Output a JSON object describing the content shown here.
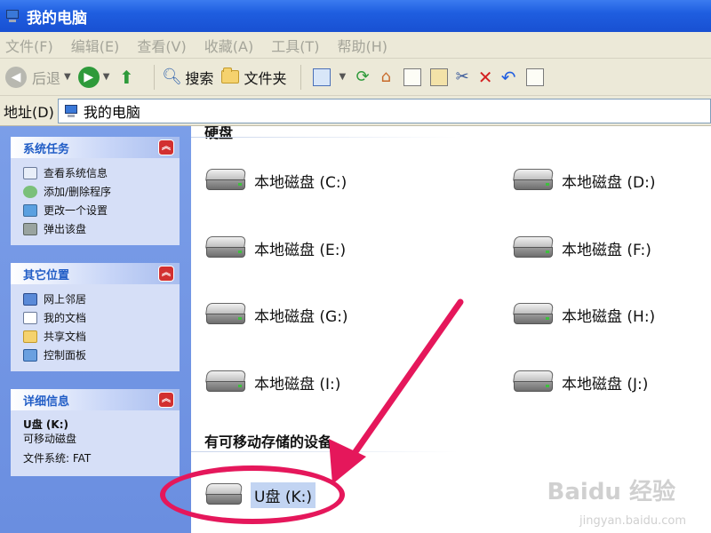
{
  "window": {
    "title": "我的电脑"
  },
  "menu": [
    "文件(F)",
    "编辑(E)",
    "查看(V)",
    "收藏(A)",
    "工具(T)",
    "帮助(H)"
  ],
  "toolbar": {
    "back_label": "后退",
    "search_label": "搜索",
    "folders_label": "文件夹"
  },
  "address": {
    "label": "地址(D)",
    "value": "我的电脑"
  },
  "panels": {
    "system_tasks": {
      "title": "系统任务",
      "items": [
        "查看系统信息",
        "添加/删除程序",
        "更改一个设置",
        "弹出该盘"
      ]
    },
    "other_places": {
      "title": "其它位置",
      "items": [
        "网上邻居",
        "我的文档",
        "共享文档",
        "控制面板"
      ]
    },
    "details": {
      "title": "详细信息",
      "name": "U盘 (K:)",
      "type": "可移动磁盘",
      "filesystem": "文件系统: FAT"
    }
  },
  "content": {
    "hdd_group_title": "硬盘",
    "drives": [
      "本地磁盘 (C:)",
      "本地磁盘 (D:)",
      "本地磁盘 (E:)",
      "本地磁盘 (F:)",
      "本地磁盘 (G:)",
      "本地磁盘 (H:)",
      "本地磁盘 (I:)",
      "本地磁盘 (J:)"
    ],
    "removable_group_title": "有可移动存储的设备",
    "usb_drive": "U盘 (K:)"
  },
  "watermark": {
    "logo": "Baidu 经验",
    "url": "jingyan.baidu.com"
  },
  "colors": {
    "annotation": "#e5175b",
    "titlebar": "#1f5ee0",
    "panel_bg": "#6a8ee0"
  }
}
